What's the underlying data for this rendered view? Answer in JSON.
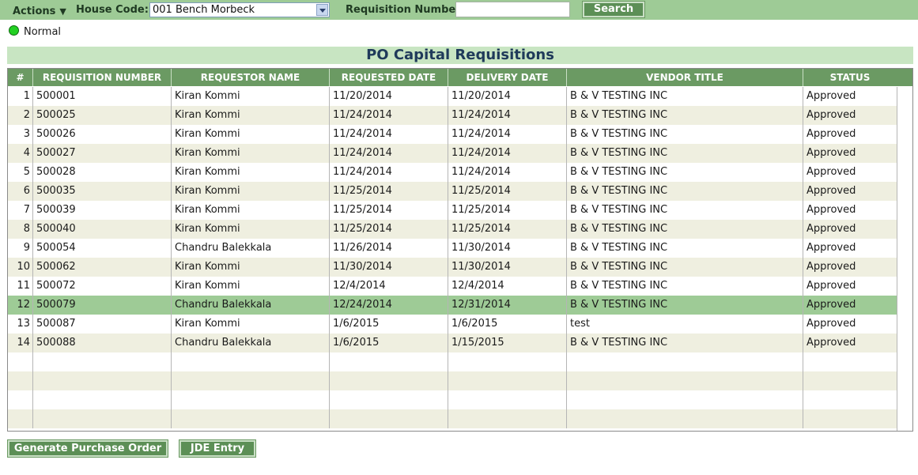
{
  "toolbar": {
    "actions_label": "Actions",
    "house_code_label": "House Code:",
    "house_code_value": "001 Bench Morbeck",
    "requisition_number_label": "Requisition Number:",
    "requisition_number_value": "",
    "search_label": "Search"
  },
  "status": {
    "text": "Normal",
    "indicator_color": "#22d022"
  },
  "title": "PO Capital Requisitions",
  "table": {
    "columns": [
      "#",
      "REQUISITION NUMBER",
      "REQUESTOR NAME",
      "REQUESTED DATE",
      "DELIVERY DATE",
      "VENDOR TITLE",
      "STATUS"
    ],
    "rows": [
      {
        "num": "1",
        "req": "500001",
        "name": "Kiran Kommi",
        "rdate": "11/20/2014",
        "ddate": "11/20/2014",
        "vendor": "B & V TESTING INC",
        "status": "Approved"
      },
      {
        "num": "2",
        "req": "500025",
        "name": "Kiran Kommi",
        "rdate": "11/24/2014",
        "ddate": "11/24/2014",
        "vendor": "B & V TESTING INC",
        "status": "Approved"
      },
      {
        "num": "3",
        "req": "500026",
        "name": "Kiran Kommi",
        "rdate": "11/24/2014",
        "ddate": "11/24/2014",
        "vendor": "B & V TESTING INC",
        "status": "Approved"
      },
      {
        "num": "4",
        "req": "500027",
        "name": "Kiran Kommi",
        "rdate": "11/24/2014",
        "ddate": "11/24/2014",
        "vendor": "B & V TESTING INC",
        "status": "Approved"
      },
      {
        "num": "5",
        "req": "500028",
        "name": "Kiran Kommi",
        "rdate": "11/24/2014",
        "ddate": "11/24/2014",
        "vendor": "B & V TESTING INC",
        "status": "Approved"
      },
      {
        "num": "6",
        "req": "500035",
        "name": "Kiran Kommi",
        "rdate": "11/25/2014",
        "ddate": "11/25/2014",
        "vendor": "B & V TESTING INC",
        "status": "Approved"
      },
      {
        "num": "7",
        "req": "500039",
        "name": "Kiran Kommi",
        "rdate": "11/25/2014",
        "ddate": "11/25/2014",
        "vendor": "B & V TESTING INC",
        "status": "Approved"
      },
      {
        "num": "8",
        "req": "500040",
        "name": "Kiran Kommi",
        "rdate": "11/25/2014",
        "ddate": "11/25/2014",
        "vendor": "B & V TESTING INC",
        "status": "Approved"
      },
      {
        "num": "9",
        "req": "500054",
        "name": "Chandru Balekkala",
        "rdate": "11/26/2014",
        "ddate": "11/30/2014",
        "vendor": "B & V TESTING INC",
        "status": "Approved"
      },
      {
        "num": "10",
        "req": "500062",
        "name": "Kiran Kommi",
        "rdate": "11/30/2014",
        "ddate": "11/30/2014",
        "vendor": "B & V TESTING INC",
        "status": "Approved"
      },
      {
        "num": "11",
        "req": "500072",
        "name": "Kiran Kommi",
        "rdate": "12/4/2014",
        "ddate": "12/4/2014",
        "vendor": "B & V TESTING INC",
        "status": "Approved"
      },
      {
        "num": "12",
        "req": "500079",
        "name": "Chandru Balekkala",
        "rdate": "12/24/2014",
        "ddate": "12/31/2014",
        "vendor": "B & V TESTING INC",
        "status": "Approved",
        "selected": true
      },
      {
        "num": "13",
        "req": "500087",
        "name": "Kiran Kommi",
        "rdate": "1/6/2015",
        "ddate": "1/6/2015",
        "vendor": "test",
        "status": "Approved"
      },
      {
        "num": "14",
        "req": "500088",
        "name": "Chandru Balekkala",
        "rdate": "1/6/2015",
        "ddate": "1/15/2015",
        "vendor": "B & V TESTING INC",
        "status": "Approved"
      }
    ],
    "empty_rows": 4
  },
  "buttons": {
    "generate_po_label": "Generate Purchase Order",
    "jde_entry_label": "JDE Entry"
  },
  "colors": {
    "toolbar_bg": "#9ecb96",
    "header_bg": "#6b9a63",
    "title_bg": "#c8e5c2",
    "row_alt": "#efefe0",
    "row_selected": "#9ecb96",
    "button_bg": "#5c8f56"
  }
}
